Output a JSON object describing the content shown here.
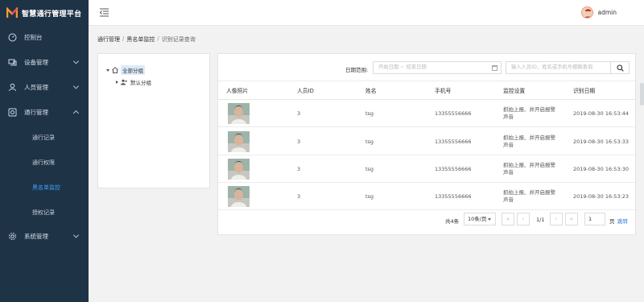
{
  "app": {
    "title": "智慧通行管理平台"
  },
  "sidebar": {
    "items": [
      {
        "label": "控制台",
        "icon": "dashboard-icon"
      },
      {
        "label": "设备管理",
        "icon": "device-icon"
      },
      {
        "label": "人员管理",
        "icon": "user-icon"
      },
      {
        "label": "通行管理",
        "icon": "access-icon"
      },
      {
        "label": "系统管理",
        "icon": "gear-icon"
      }
    ],
    "sub_items": [
      {
        "label": "通行记录"
      },
      {
        "label": "通行权限"
      },
      {
        "label": "黑名单监控",
        "active": true
      },
      {
        "label": "授权记录"
      }
    ]
  },
  "header": {
    "username": "admin"
  },
  "breadcrumb": [
    "通行管理",
    "黑名单监控",
    "识别记录查询"
  ],
  "tree": {
    "root": "全部分组",
    "child": "默认分组"
  },
  "filters": {
    "date_label": "日期范围:",
    "date_placeholder": "开始日期 ~ 结束日期",
    "search_placeholder": "输入人员ID、姓名或手机号模糊查询"
  },
  "table": {
    "columns": [
      "人像照片",
      "人员ID",
      "姓名",
      "手机号",
      "监控设置",
      "识别日期"
    ],
    "rows": [
      {
        "id": "3",
        "name": "tsg",
        "phone": "13355556666",
        "alarm": "抓拍上报、并开启报警声音",
        "date": "2019-08-30 16:53:44"
      },
      {
        "id": "3",
        "name": "tsg",
        "phone": "13355556666",
        "alarm": "抓拍上报、并开启报警声音",
        "date": "2019-08-30 16:53:33"
      },
      {
        "id": "3",
        "name": "tsg",
        "phone": "13355556666",
        "alarm": "抓拍上报、并开启报警声音",
        "date": "2019-08-30 16:53:30"
      },
      {
        "id": "3",
        "name": "tsg",
        "phone": "13355556666",
        "alarm": "抓拍上报、并开启报警声音",
        "date": "2019-08-30 16:53:23"
      }
    ]
  },
  "pagination": {
    "total": "共4条",
    "page_size": "10条/页",
    "first": "«",
    "prev": "‹",
    "info": "1/1",
    "next": "›",
    "last": "»",
    "page_input": "1",
    "page_suffix": "页",
    "jump": "跳转"
  },
  "colors": {
    "sidebar_bg": "#1f3347",
    "active_link": "#3ea0ff",
    "accent_blue": "#2a7ae2"
  }
}
